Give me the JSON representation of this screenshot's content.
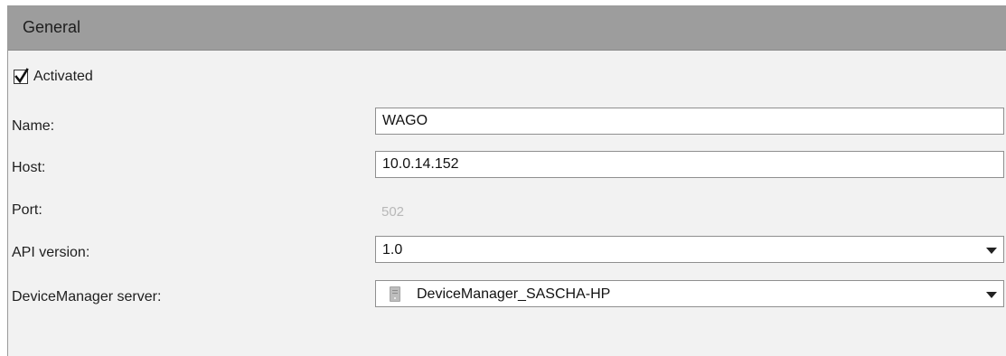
{
  "section": {
    "title": "General"
  },
  "activated": {
    "label": "Activated",
    "checked": true
  },
  "fields": {
    "name": {
      "label": "Name:",
      "value": "WAGO"
    },
    "host": {
      "label": "Host:",
      "value": "10.0.14.152"
    },
    "port": {
      "label": "Port:",
      "value": "502"
    },
    "api_version": {
      "label": "API version:",
      "value": "1.0"
    },
    "device_manager_server": {
      "label": "DeviceManager server:",
      "value": "DeviceManager_SASCHA-HP",
      "icon": "server-icon"
    }
  },
  "colors": {
    "header_bg": "#9d9d9d",
    "panel_bg": "#f2f2f2",
    "disabled_text": "#b8b8b8"
  }
}
